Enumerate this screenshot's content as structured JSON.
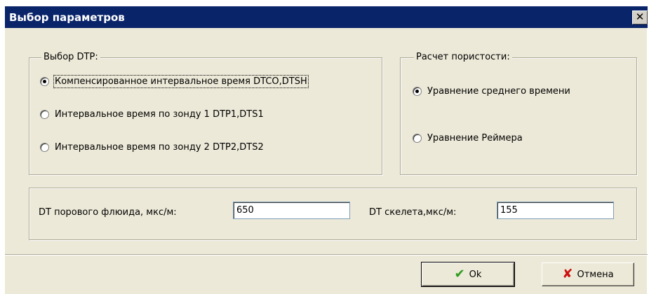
{
  "window": {
    "title": "Выбор параметров",
    "close_label": "✕"
  },
  "dtp_group": {
    "legend": "Выбор DTP:",
    "options": [
      {
        "label": "Компенсированное интервальное время DTCO,DTSH",
        "selected": true
      },
      {
        "label": "Интервальное время по зонду 1 DTP1,DTS1",
        "selected": false
      },
      {
        "label": "Интервальное время по зонду 2 DTP2,DTS2",
        "selected": false
      }
    ]
  },
  "porosity_group": {
    "legend": "Расчет пористости:",
    "options": [
      {
        "label": "Уравнение среднего времени",
        "selected": true
      },
      {
        "label": "Уравнение Реймера",
        "selected": false
      }
    ]
  },
  "params": {
    "fluid_label": "DT порового флюида, мкс/м:",
    "fluid_value": "650",
    "skeleton_label": "DT скелета,мкс/м:",
    "skeleton_value": "155"
  },
  "buttons": {
    "ok_label": "Ok",
    "cancel_label": "Отмена",
    "ok_icon": "check-icon",
    "cancel_icon": "cross-icon",
    "ok_icon_color": "#2e9a1f",
    "cancel_icon_color": "#cc1010"
  }
}
